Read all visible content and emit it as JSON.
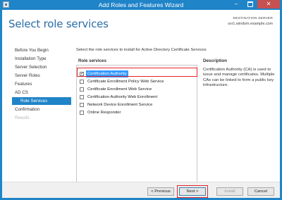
{
  "window": {
    "title": "Add Roles and Features Wizard",
    "minimize_glyph": "–",
    "close_glyph": "✕"
  },
  "header": {
    "page_title": "Select role services",
    "destination_label": "DESTINATION SERVER",
    "destination_server": "svr1.windom.example.com"
  },
  "nav": {
    "items": [
      {
        "label": "Before You Begin",
        "state": "normal"
      },
      {
        "label": "Installation Type",
        "state": "normal"
      },
      {
        "label": "Server Selection",
        "state": "normal"
      },
      {
        "label": "Server Roles",
        "state": "normal"
      },
      {
        "label": "Features",
        "state": "normal"
      },
      {
        "label": "AD CS",
        "state": "normal"
      },
      {
        "label": "Role Services",
        "state": "selected"
      },
      {
        "label": "Confirmation",
        "state": "normal"
      },
      {
        "label": "Results",
        "state": "disabled"
      }
    ]
  },
  "main": {
    "instruction": "Select the role services to install for Active Directory Certificate Services",
    "roles_heading": "Role services",
    "description_heading": "Description",
    "role_services": [
      {
        "label": "Certification Authority",
        "checked": true,
        "selected": true
      },
      {
        "label": "Certificate Enrollment Policy Web Service",
        "checked": false,
        "selected": false
      },
      {
        "label": "Certificate Enrollment Web Service",
        "checked": false,
        "selected": false
      },
      {
        "label": "Certification Authority Web Enrollment",
        "checked": false,
        "selected": false
      },
      {
        "label": "Network Device Enrollment Service",
        "checked": false,
        "selected": false
      },
      {
        "label": "Online Responder",
        "checked": false,
        "selected": false
      }
    ],
    "check_glyph": "✓",
    "description_text": "Certification Authority (CA) is used to issue and manage certificates. Multiple CAs can be linked to form a public key infrastructure."
  },
  "footer": {
    "previous_label": "< Previous",
    "next_label": "Next >",
    "install_label": "Install",
    "cancel_label": "Cancel"
  },
  "colors": {
    "title_bar": "#1f84c8",
    "selected_nav": "#1f84c8",
    "highlight_annotation": "#e0242a",
    "selection": "#3399ff"
  }
}
